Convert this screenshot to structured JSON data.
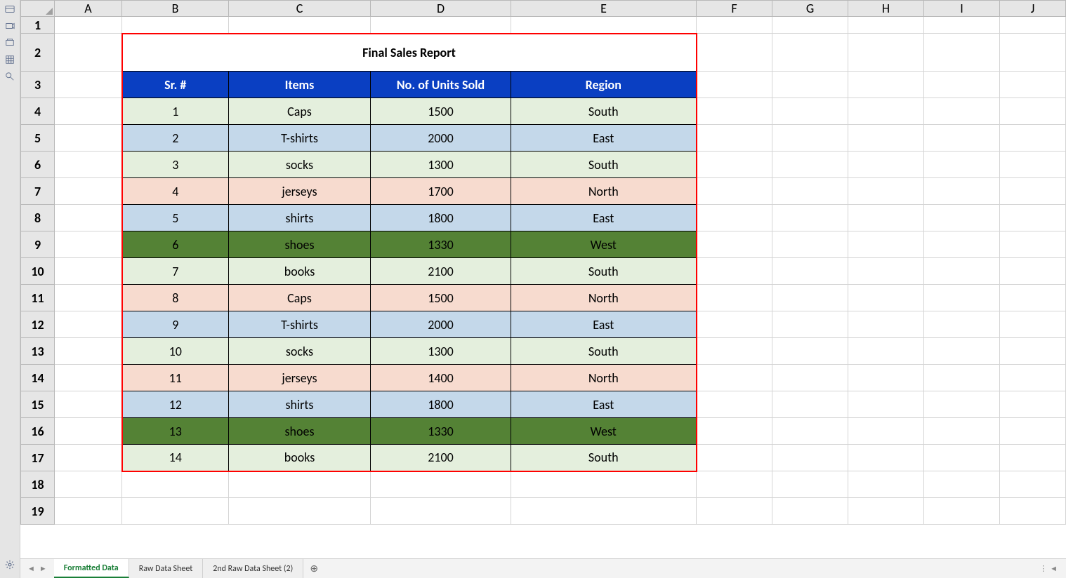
{
  "columns": [
    "A",
    "B",
    "C",
    "D",
    "E",
    "F",
    "G",
    "H",
    "I",
    "J"
  ],
  "rowCount": 19,
  "title": "Final Sales Report",
  "headers": [
    "Sr. #",
    "Items",
    "No. of Units Sold",
    "Region"
  ],
  "rows": [
    {
      "sr": "1",
      "item": "Caps",
      "units": "1500",
      "region": "South",
      "cls": "bg-green-light"
    },
    {
      "sr": "2",
      "item": "T-shirts",
      "units": "2000",
      "region": "East",
      "cls": "bg-blue-light"
    },
    {
      "sr": "3",
      "item": "socks",
      "units": "1300",
      "region": "South",
      "cls": "bg-green-light"
    },
    {
      "sr": "4",
      "item": "jerseys",
      "units": "1700",
      "region": "North",
      "cls": "bg-peach"
    },
    {
      "sr": "5",
      "item": "shirts",
      "units": "1800",
      "region": "East",
      "cls": "bg-blue-light"
    },
    {
      "sr": "6",
      "item": "shoes",
      "units": "1330",
      "region": "West",
      "cls": "bg-green-dark"
    },
    {
      "sr": "7",
      "item": "books",
      "units": "2100",
      "region": "South",
      "cls": "bg-green-light"
    },
    {
      "sr": "8",
      "item": "Caps",
      "units": "1500",
      "region": "North",
      "cls": "bg-peach"
    },
    {
      "sr": "9",
      "item": "T-shirts",
      "units": "2000",
      "region": "East",
      "cls": "bg-blue-light"
    },
    {
      "sr": "10",
      "item": "socks",
      "units": "1300",
      "region": "South",
      "cls": "bg-green-light"
    },
    {
      "sr": "11",
      "item": "jerseys",
      "units": "1400",
      "region": "North",
      "cls": "bg-peach"
    },
    {
      "sr": "12",
      "item": "shirts",
      "units": "1800",
      "region": "East",
      "cls": "bg-blue-light"
    },
    {
      "sr": "13",
      "item": "shoes",
      "units": "1330",
      "region": "West",
      "cls": "bg-green-dark"
    },
    {
      "sr": "14",
      "item": "books",
      "units": "2100",
      "region": "South",
      "cls": "bg-green-light"
    }
  ],
  "tabs": [
    {
      "label": "Formatted Data",
      "active": true
    },
    {
      "label": "Raw Data Sheet",
      "active": false
    },
    {
      "label": "2nd Raw Data Sheet  (2)",
      "active": false
    }
  ]
}
